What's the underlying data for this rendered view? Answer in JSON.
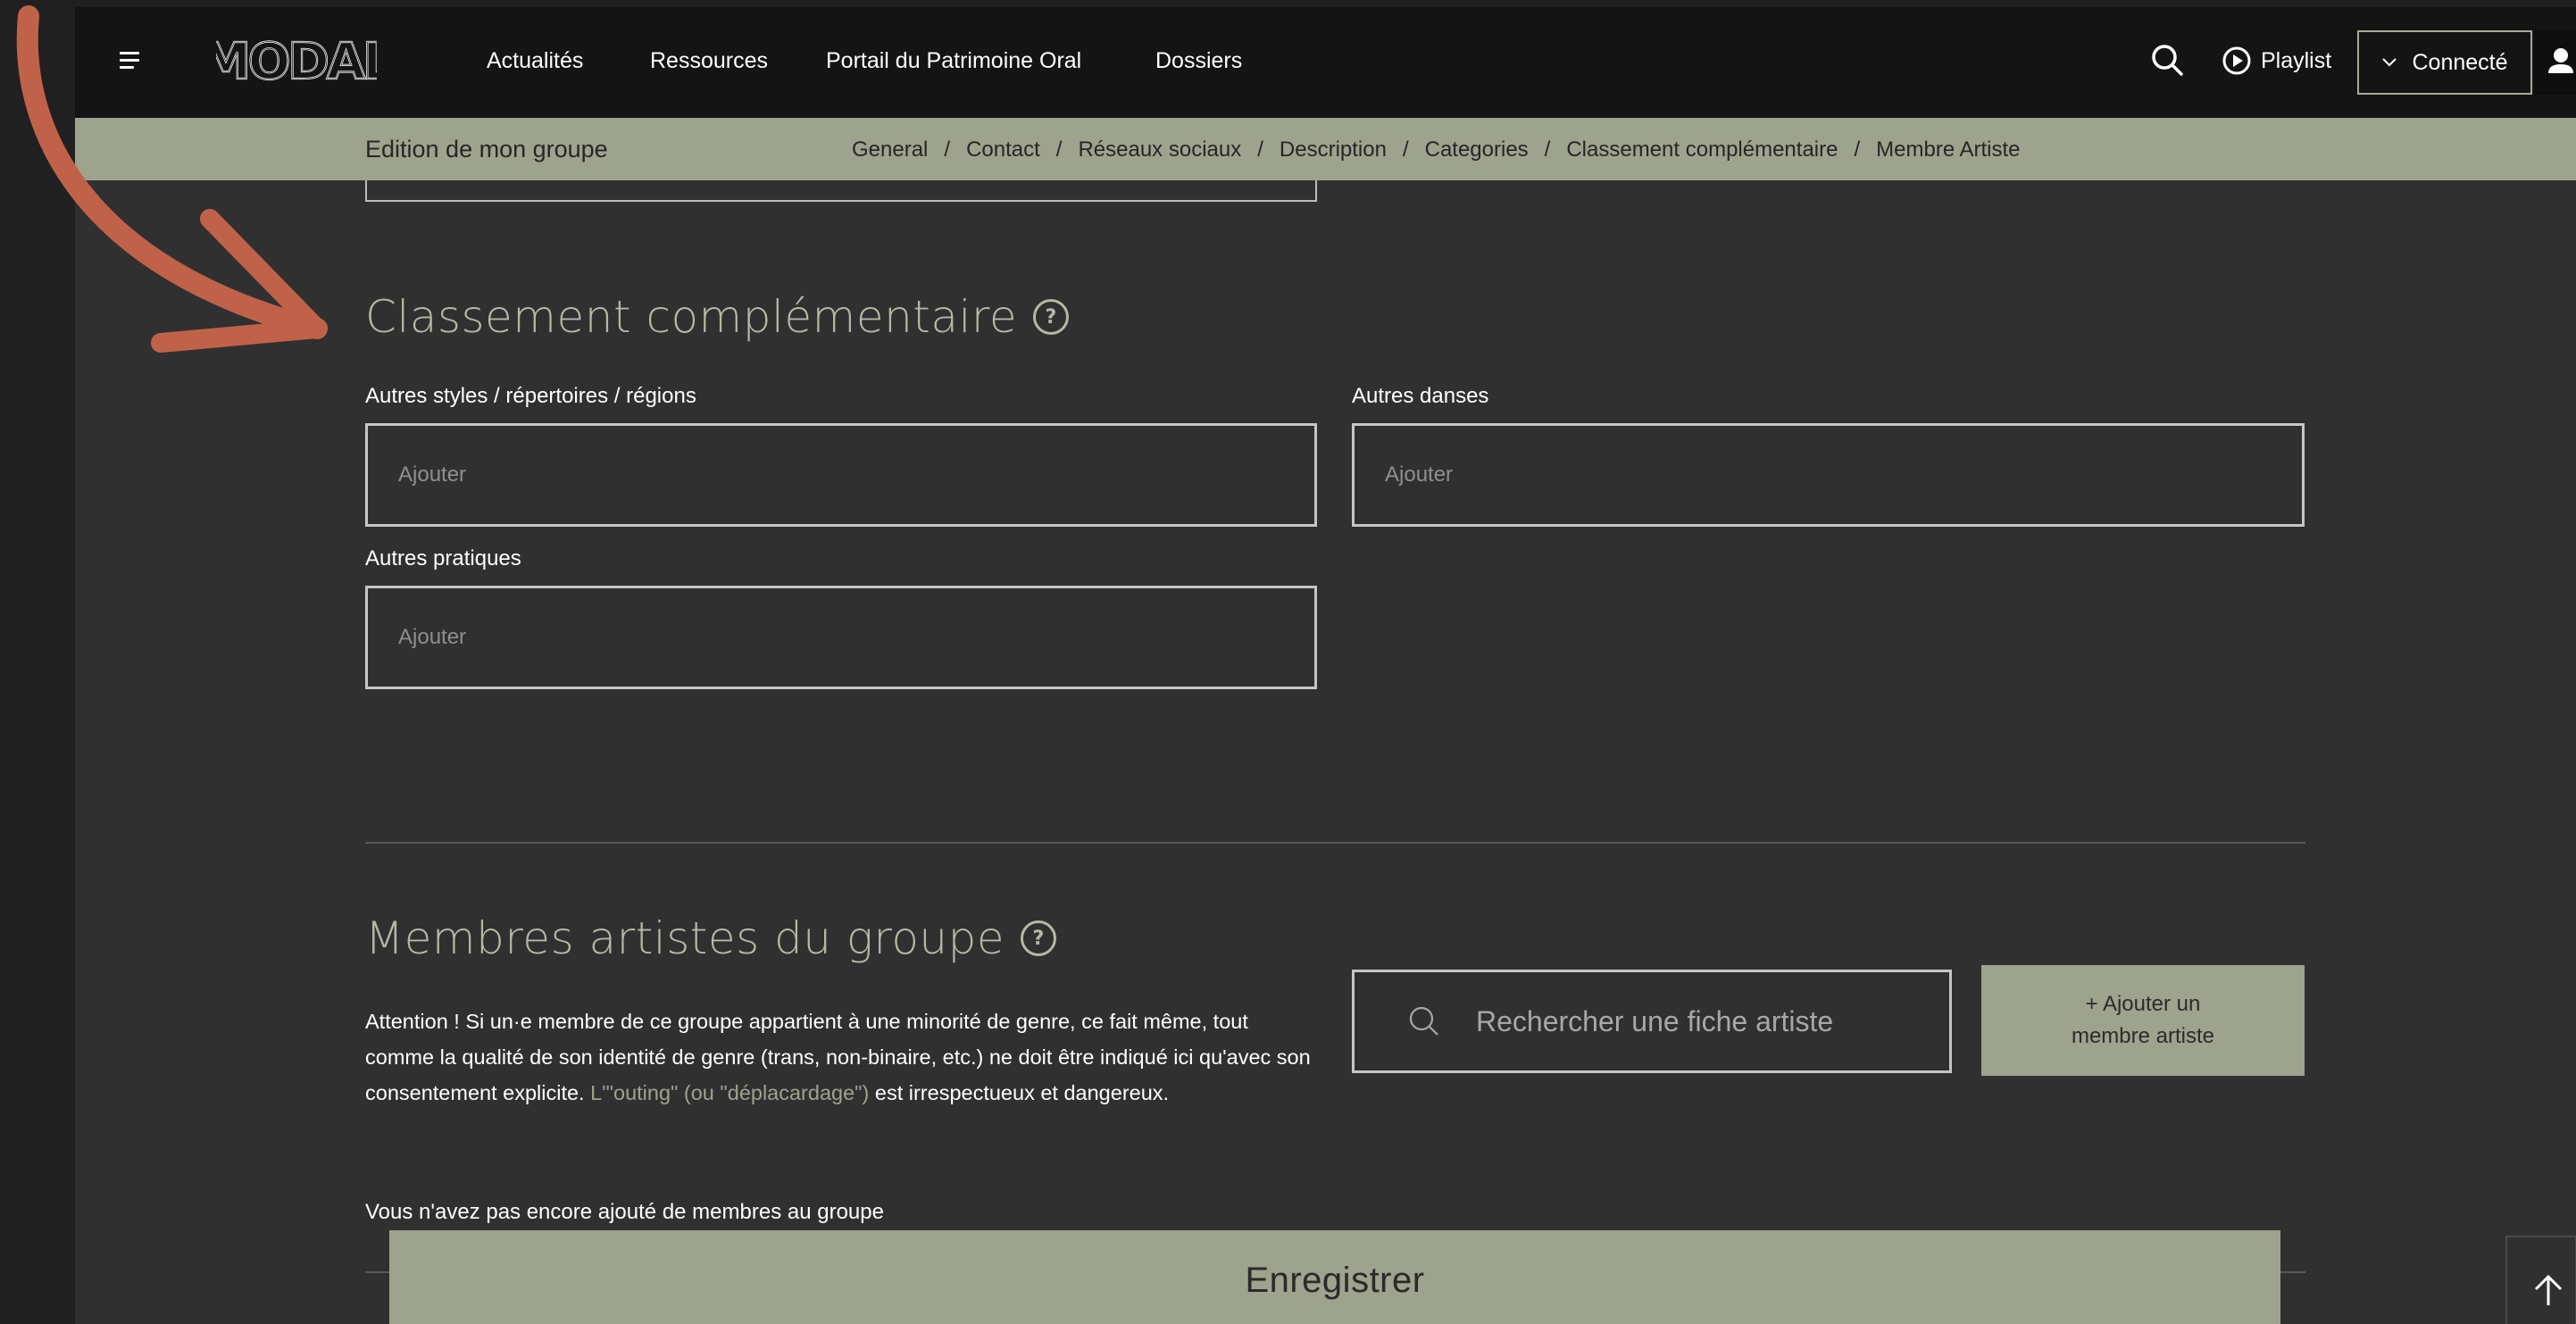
{
  "header": {
    "logo_text": "MODAL",
    "nav": [
      "Actualités",
      "Ressources",
      "Portail du Patrimoine Oral",
      "Dossiers"
    ],
    "playlist_label": "Playlist",
    "connect_label": "Connecté",
    "icons": {
      "menu": "hamburger-icon",
      "search": "search-icon",
      "play": "play-circle-icon",
      "chevron": "chevron-down-icon",
      "user": "user-icon"
    }
  },
  "subnav": {
    "title": "Edition de mon groupe",
    "links": [
      "General",
      "Contact",
      "Réseaux sociaux",
      "Description",
      "Categories",
      "Classement complémentaire",
      "Membre Artiste"
    ],
    "separator": "/"
  },
  "classement": {
    "title": "Classement complémentaire",
    "help_glyph": "?",
    "fields": [
      {
        "label": "Autres styles / répertoires / régions",
        "placeholder": "Ajouter"
      },
      {
        "label": "Autres danses",
        "placeholder": "Ajouter"
      },
      {
        "label": "Autres pratiques",
        "placeholder": "Ajouter"
      }
    ]
  },
  "membres": {
    "title": "Membres artistes du groupe",
    "help_glyph": "?",
    "notice_before": "Attention ! Si un·e membre de ce groupe appartient à une minorité de genre, ce fait même, tout comme la qualité de son identité de genre (trans, non-binaire, etc.) ne doit être indiqué ici qu'avec son consentement explicite. ",
    "notice_link": "L'\"outing\" (ou \"déplacardage\")",
    "notice_after": "  est irrespectueux et dangereux.",
    "search_placeholder": "Rechercher une fiche artiste",
    "add_button": "+ Ajouter un membre artiste",
    "empty_message": "Vous n'avez pas encore ajouté de membres au groupe"
  },
  "footer": {
    "save_label": "Enregistrer",
    "scroll_top_icon": "arrow-up-icon"
  },
  "colors": {
    "accent": "#9ea38d",
    "title": "#b4b9a4",
    "background": "#303030",
    "topbar": "#141414",
    "annotation_arrow": "#c0624a"
  }
}
